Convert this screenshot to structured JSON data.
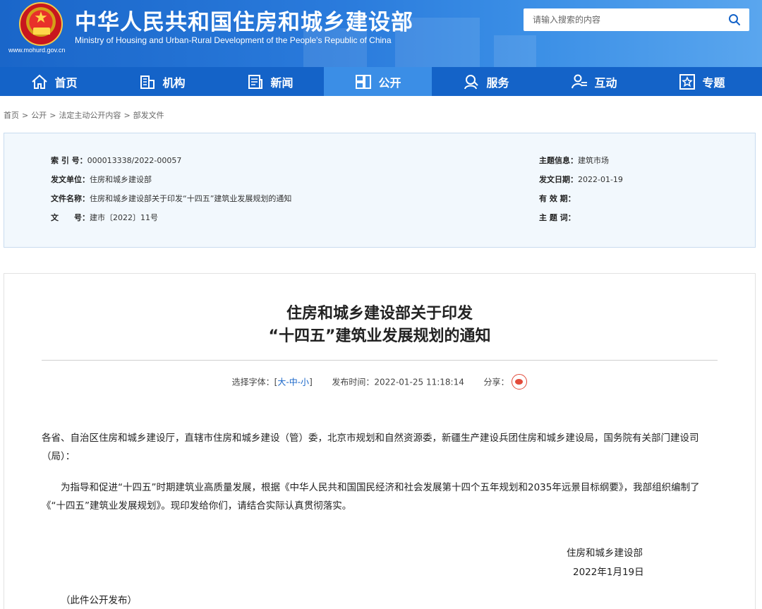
{
  "header": {
    "title": "中华人民共和国住房和城乡建设部",
    "subtitle": "Ministry of Housing and Urban-Rural Development of the People's Republic of China",
    "url": "www.mohurd.gov.cn",
    "search_placeholder": "请输入搜索的内容",
    "colors": {
      "banner": "#1a66c9",
      "nav": "#1463c8",
      "nav_active": "#3b8ee6"
    }
  },
  "nav": [
    {
      "label": "首页",
      "icon": "home-icon"
    },
    {
      "label": "机构",
      "icon": "building-icon"
    },
    {
      "label": "新闻",
      "icon": "news-icon"
    },
    {
      "label": "公开",
      "icon": "disclosure-icon",
      "active": true
    },
    {
      "label": "服务",
      "icon": "service-icon"
    },
    {
      "label": "互动",
      "icon": "interaction-icon"
    },
    {
      "label": "专题",
      "icon": "topic-icon"
    }
  ],
  "breadcrumb": [
    "首页",
    "公开",
    "法定主动公开内容",
    "部发文件"
  ],
  "meta": {
    "index_key": "索 引 号：",
    "index_val": "000013338/2022-00057",
    "issuer_key": "发文单位：",
    "issuer_val": "住房和城乡建设部",
    "docname_key": "文件名称：",
    "docname_val": "住房和城乡建设部关于印发“十四五”建筑业发展规划的通知",
    "docno_key": "文　　号：",
    "docno_val": "建市〔2022〕11号",
    "topic_key": "主题信息：",
    "topic_val": "建筑市场",
    "date_key": "发文日期：",
    "date_val": "2022-01-19",
    "validity_key": "有 效 期：",
    "validity_val": "",
    "keywords_key": "主 题 词：",
    "keywords_val": ""
  },
  "article": {
    "title_line1": "住房和城乡建设部关于印发",
    "title_line2": "“十四五”建筑业发展规划的通知",
    "font_label": "选择字体：[",
    "font_large": "大",
    "font_medium": "中",
    "font_small": "小",
    "font_sep": "-",
    "font_close": "]",
    "publish_time": "发布时间：2022-01-25 11:18:14",
    "share_label": "分享：",
    "para1": "各省、自治区住房和城乡建设厅，直辖市住房和城乡建设（管）委，北京市规划和自然资源委，新疆生产建设兵团住房和城乡建设局，国务院有关部门建设司（局）：",
    "para2": "为指导和促进“十四五”时期建筑业高质量发展，根据《中华人民共和国国民经济和社会发展第十四个五年规划和2035年远景目标纲要》，我部组织编制了《“十四五”建筑业发展规划》。现印发给你们，请结合实际认真贯彻落实。",
    "sign_org": "住房和城乡建设部",
    "sign_date": "2022年1月19日",
    "note": "（此件公开发布）"
  }
}
